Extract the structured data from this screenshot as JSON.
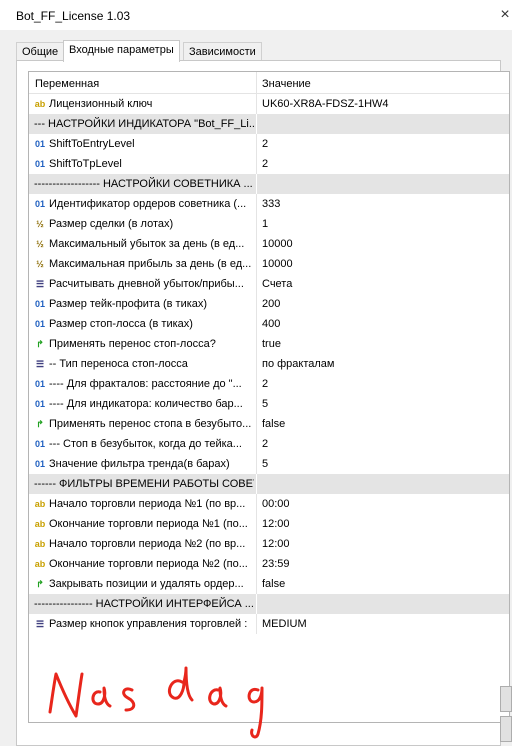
{
  "window": {
    "title": "Bot_FF_License 1.03",
    "close_glyph": "×"
  },
  "tabs": [
    {
      "label": "Общие"
    },
    {
      "label": "Входные параметры",
      "active": true
    },
    {
      "label": "Зависимости"
    }
  ],
  "grid": {
    "col_variable": "Переменная",
    "col_value": "Значение",
    "rows": [
      {
        "type": "param",
        "icon": "text-icon",
        "glyph": "ab",
        "name": "Лицензионный ключ",
        "value": "UK60-XR8A-FDSZ-1HW4"
      },
      {
        "type": "section",
        "name": "---   НАСТРОЙКИ ИНДИКАТОРА \"Bot_FF_Li...",
        "value": ""
      },
      {
        "type": "param",
        "icon": "integer-icon",
        "glyph": "01",
        "name": "ShiftToEntryLevel",
        "value": "2"
      },
      {
        "type": "param",
        "icon": "integer-icon",
        "glyph": "01",
        "name": "ShiftToTpLevel",
        "value": "2"
      },
      {
        "type": "section",
        "name": "------------------   НАСТРОЙКИ СОВЕТНИКА ...",
        "value": ""
      },
      {
        "type": "param",
        "icon": "integer-icon",
        "glyph": "01",
        "name": "Идентификатор ордеров советника (...",
        "value": "333"
      },
      {
        "type": "param",
        "icon": "double-icon",
        "glyph": "½",
        "name": "Размер сделки (в лотах)",
        "value": "1"
      },
      {
        "type": "param",
        "icon": "double-icon",
        "glyph": "½",
        "name": "Максимальный убыток за день (в ед...",
        "value": "10000"
      },
      {
        "type": "param",
        "icon": "double-icon",
        "glyph": "½",
        "name": "Максимальная прибыль за день (в ед...",
        "value": "10000"
      },
      {
        "type": "param",
        "icon": "enum-icon",
        "glyph": "☰",
        "name": "Расчитывать дневной убыток/прибы...",
        "value": "Счета"
      },
      {
        "type": "param",
        "icon": "integer-icon",
        "glyph": "01",
        "name": "Размер тейк-профита (в тиках)",
        "value": "200"
      },
      {
        "type": "param",
        "icon": "integer-icon",
        "glyph": "01",
        "name": "Размер стоп-лосса (в тиках)",
        "value": "400"
      },
      {
        "type": "param",
        "icon": "bool-icon",
        "glyph": "↱",
        "name": "Применять перенос стоп-лосса?",
        "value": "true"
      },
      {
        "type": "param",
        "icon": "enum-icon",
        "glyph": "☰",
        "name": "-- Тип переноса стоп-лосса",
        "value": "по фракталам"
      },
      {
        "type": "param",
        "icon": "integer-icon",
        "glyph": "01",
        "name": "---- Для фракталов: расстояние до \"...",
        "value": "2"
      },
      {
        "type": "param",
        "icon": "integer-icon",
        "glyph": "01",
        "name": "---- Для индикатора: количество бар...",
        "value": "5"
      },
      {
        "type": "param",
        "icon": "bool-icon",
        "glyph": "↱",
        "name": "Применять перенос стопа в безубыто...",
        "value": "false"
      },
      {
        "type": "param",
        "icon": "integer-icon",
        "glyph": "01",
        "name": "--- Стоп в безубыток, когда до тейка...",
        "value": "2"
      },
      {
        "type": "param",
        "icon": "integer-icon",
        "glyph": "01",
        "name": "Значение фильтра тренда(в барах)",
        "value": "5"
      },
      {
        "type": "section",
        "name": "------   ФИЛЬТРЫ ВРЕМЕНИ РАБОТЫ СОВЕТ...",
        "value": ""
      },
      {
        "type": "param",
        "icon": "text-icon",
        "glyph": "ab",
        "name": "Начало торговли периода №1 (по вр...",
        "value": "00:00"
      },
      {
        "type": "param",
        "icon": "text-icon",
        "glyph": "ab",
        "name": "Окончание торговли периода №1 (по...",
        "value": "12:00"
      },
      {
        "type": "param",
        "icon": "text-icon",
        "glyph": "ab",
        "name": "Начало торговли периода №2 (по вр...",
        "value": "12:00"
      },
      {
        "type": "param",
        "icon": "text-icon",
        "glyph": "ab",
        "name": "Окончание торговли периода №2 (по...",
        "value": "23:59"
      },
      {
        "type": "param",
        "icon": "bool-icon",
        "glyph": "↱",
        "name": "Закрывать позиции и удалять ордер...",
        "value": "false"
      },
      {
        "type": "section",
        "name": "----------------   НАСТРОЙКИ ИНТЕРФЕЙСА ...",
        "value": ""
      },
      {
        "type": "param",
        "icon": "enum-icon",
        "glyph": "☰",
        "name": "Размер кнопок управления торговлей :",
        "value": "MEDIUM"
      }
    ]
  },
  "handwriting": {
    "text": "Nasdaq",
    "color": "#e8261c"
  }
}
